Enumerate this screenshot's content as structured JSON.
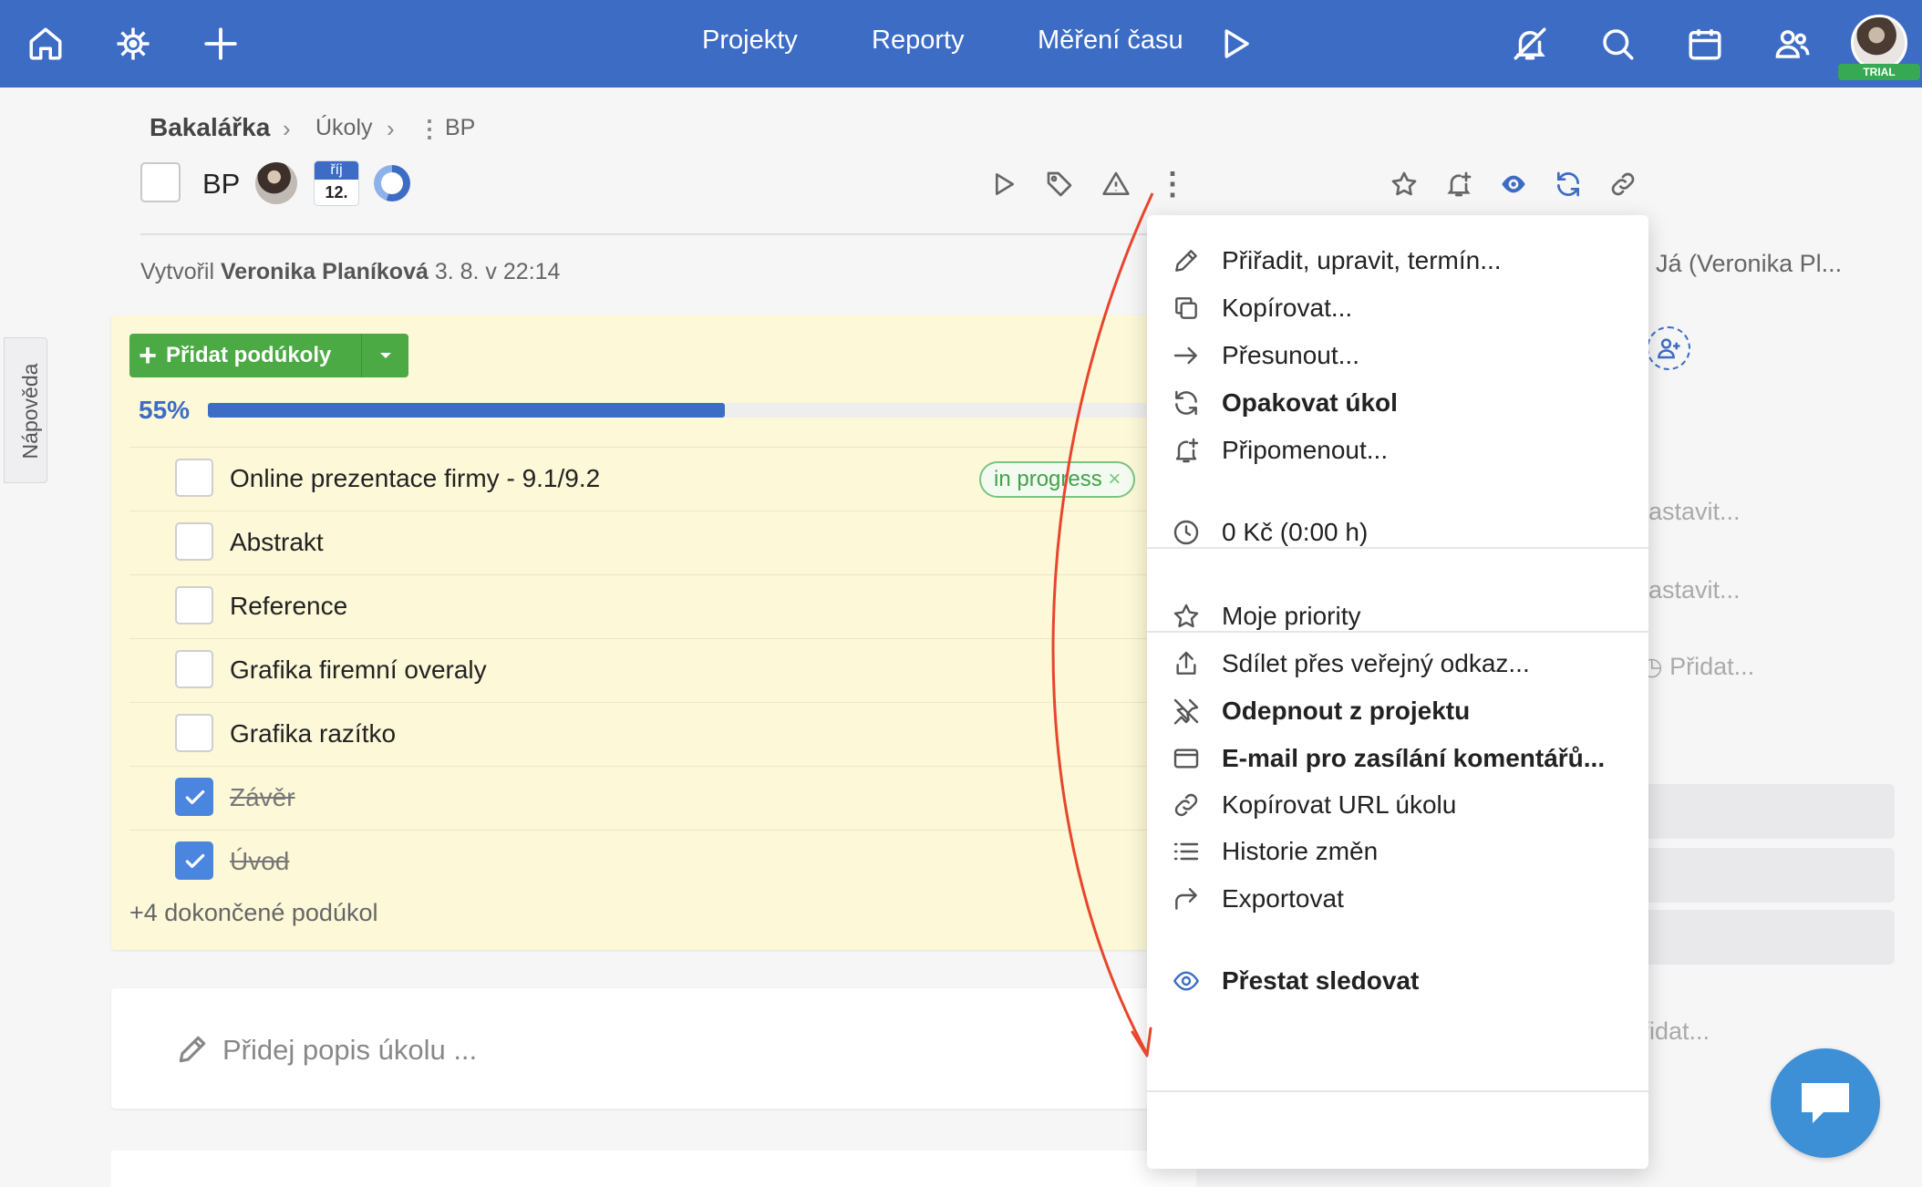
{
  "topbar": {
    "nav": [
      "Projekty",
      "Reporty",
      "Měření času"
    ],
    "trial_badge": "TRIAL",
    "accent_color": "#3d6cc5"
  },
  "breadcrumb": {
    "project": "Bakalářka",
    "section": "Úkoly",
    "task": "BP"
  },
  "task": {
    "title": "BP",
    "due_month": "říj",
    "due_day": "12.",
    "progress_fraction": 0.55
  },
  "created": {
    "prefix": "Vytvořil",
    "author": "Veronika Planíková",
    "date": "3. 8. v 22:14"
  },
  "subtasks": {
    "add_button_label": "Přidat podúkoly",
    "progress_label": "55%",
    "progress_value": 0.55,
    "items": [
      {
        "label": "Online prezentace firmy - 9.1/9.2",
        "done": false
      },
      {
        "label": "Abstrakt",
        "done": false
      },
      {
        "label": "Reference",
        "done": false
      },
      {
        "label": "Grafika firemní overaly",
        "done": false
      },
      {
        "label": "Grafika razítko",
        "done": false
      },
      {
        "label": "Závěr",
        "done": true
      },
      {
        "label": "Úvod",
        "done": true
      }
    ],
    "tag": "in progress",
    "completed_more": "+4 dokončené podúkol"
  },
  "description": {
    "placeholder": "Přidej popis úkolu ..."
  },
  "right_panel": {
    "follower": "Já (Veronika Pl...",
    "set_1": "astavit...",
    "set_2": "astavit...",
    "add_time": "Přidat...",
    "add_2": "řidat..."
  },
  "help_tab": "Nápověda",
  "menu": {
    "items": [
      {
        "label": "Přiřadit, upravit, termín...",
        "icon": "pencil-icon",
        "bold": false
      },
      {
        "label": "Kopírovat...",
        "icon": "copy-icon",
        "bold": false
      },
      {
        "label": "Přesunout...",
        "icon": "arrow-right-icon",
        "bold": false
      },
      {
        "label": "Opakovat úkol",
        "icon": "repeat-icon",
        "bold": true
      },
      {
        "label": "Připomenout...",
        "icon": "bell-plus-icon",
        "bold": false
      },
      {
        "label": "0 Kč (0:00 h)",
        "icon": "clock-icon",
        "bold": false
      },
      {
        "label": "Moje priority",
        "icon": "star-icon",
        "bold": false
      },
      {
        "label": "Sdílet přes veřejný odkaz...",
        "icon": "share-icon",
        "bold": false
      },
      {
        "label": "Odepnout z projektu",
        "icon": "unpin-icon",
        "bold": true
      },
      {
        "label": "E-mail pro zasílání komentářů...",
        "icon": "mail-icon",
        "bold": true
      },
      {
        "label": "Kopírovat URL úkolu",
        "icon": "link-icon",
        "bold": false
      },
      {
        "label": "Historie změn",
        "icon": "list-icon",
        "bold": false
      },
      {
        "label": "Exportovat",
        "icon": "export-icon",
        "bold": false
      },
      {
        "label": "Přestat sledovat",
        "icon": "eye-icon",
        "bold": true
      }
    ]
  },
  "annotation": {
    "arrow_color": "#e8452c"
  }
}
